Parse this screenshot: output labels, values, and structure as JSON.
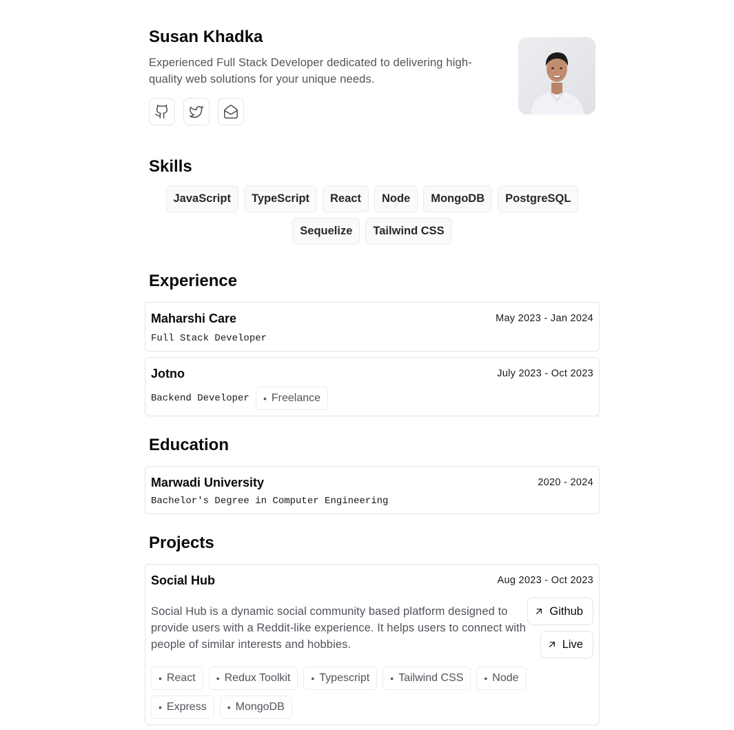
{
  "profile": {
    "name": "Susan Khadka",
    "tagline": "Experienced Full Stack Developer dedicated to delivering high-quality web solutions for your unique needs.",
    "socials": [
      {
        "icon": "github-icon"
      },
      {
        "icon": "twitter-icon"
      },
      {
        "icon": "mail-open-icon"
      }
    ]
  },
  "skills": {
    "title": "Skills",
    "items": [
      "JavaScript",
      "TypeScript",
      "React",
      "Node",
      "MongoDB",
      "PostgreSQL",
      "Sequelize",
      "Tailwind CSS"
    ]
  },
  "experience": {
    "title": "Experience",
    "items": [
      {
        "company": "Maharshi Care",
        "dates": "May 2023 - Jan 2024",
        "role": "Full Stack Developer"
      },
      {
        "company": "Jotno",
        "dates": "July 2023 - Oct 2023",
        "role": "Backend Developer",
        "tag": "Freelance"
      }
    ]
  },
  "education": {
    "title": "Education",
    "items": [
      {
        "school": "Marwadi University",
        "dates": "2020 - 2024",
        "degree": "Bachelor's Degree in Computer Engineering"
      }
    ]
  },
  "projects": {
    "title": "Projects",
    "items": [
      {
        "name": "Social Hub",
        "dates": "Aug 2023 - Oct 2023",
        "description": "Social Hub is a dynamic social community based platform designed to provide users with a Reddit-like experience. It helps users to connect with people of similar interests and hobbies.",
        "links": [
          "Github",
          "Live"
        ],
        "tech": [
          "React",
          "Redux Toolkit",
          "Typescript",
          "Tailwind CSS",
          "Node",
          "Express",
          "MongoDB"
        ]
      }
    ]
  },
  "colors": {
    "text": "#0a0a0a",
    "muted": "#52525b",
    "border": "#e4e4e7"
  }
}
